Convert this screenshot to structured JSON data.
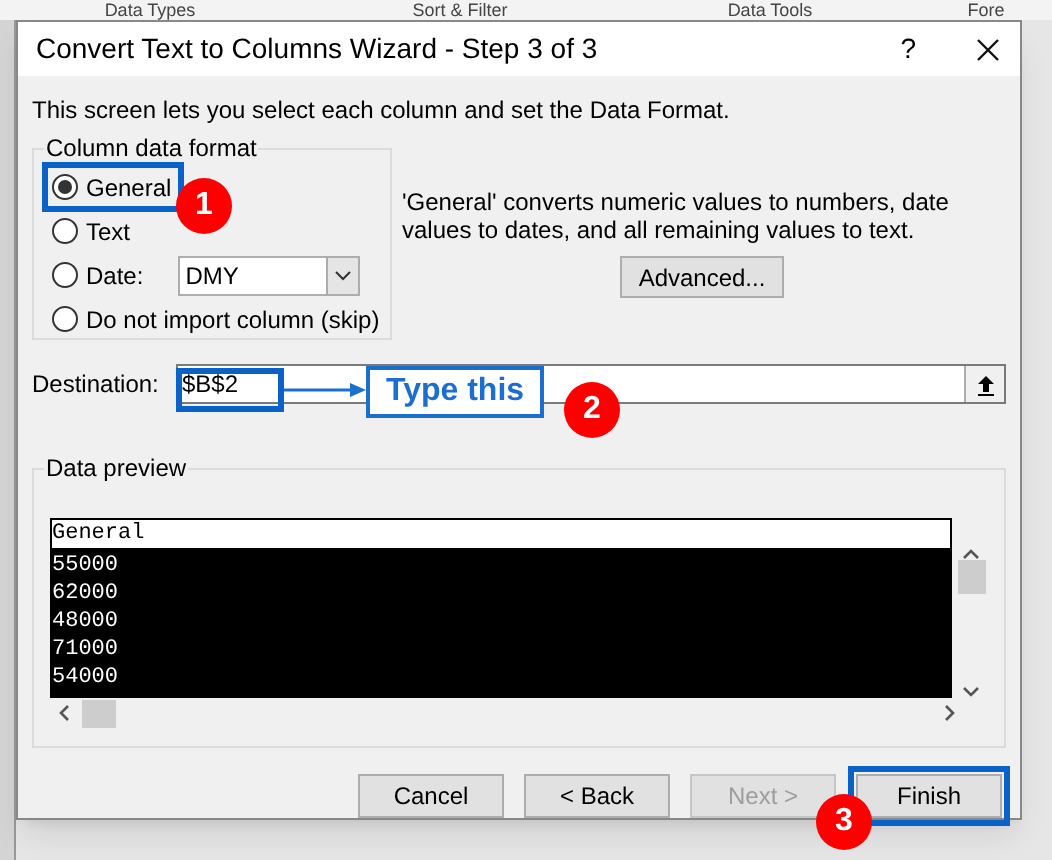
{
  "ribbon_groups": [
    "Data Types",
    "Sort & Filter",
    "Data Tools",
    "Fore"
  ],
  "dialog": {
    "title": "Convert Text to Columns Wizard - Step 3 of 3",
    "help": "?"
  },
  "intro": "This screen lets you select each column and set the Data Format.",
  "column_data_format": {
    "legend": "Column data format",
    "options": [
      {
        "label": "General",
        "selected": true,
        "kind": "plain",
        "callout": "1"
      },
      {
        "label": "Text",
        "selected": false,
        "kind": "plain"
      },
      {
        "label": "Date:",
        "selected": false,
        "kind": "date",
        "value": "DMY"
      },
      {
        "label": "Do not import column (skip)",
        "selected": false,
        "kind": "plain"
      }
    ]
  },
  "description": "'General' converts numeric values to numbers, date values to dates, and all remaining values to text.",
  "advanced_button": "Advanced...",
  "destination": {
    "label": "Destination:",
    "value": "$B$2",
    "callout": {
      "number": "2",
      "note": "Type this"
    }
  },
  "data_preview": {
    "legend": "Data preview",
    "header": "General",
    "rows": [
      "55000",
      "62000",
      "48000",
      "71000",
      "54000"
    ]
  },
  "buttons": [
    {
      "label": "Cancel",
      "disabled": false
    },
    {
      "label": "< Back",
      "disabled": false
    },
    {
      "label": "Next >",
      "disabled": true
    },
    {
      "label": "Finish",
      "disabled": false,
      "callout": "3"
    }
  ]
}
